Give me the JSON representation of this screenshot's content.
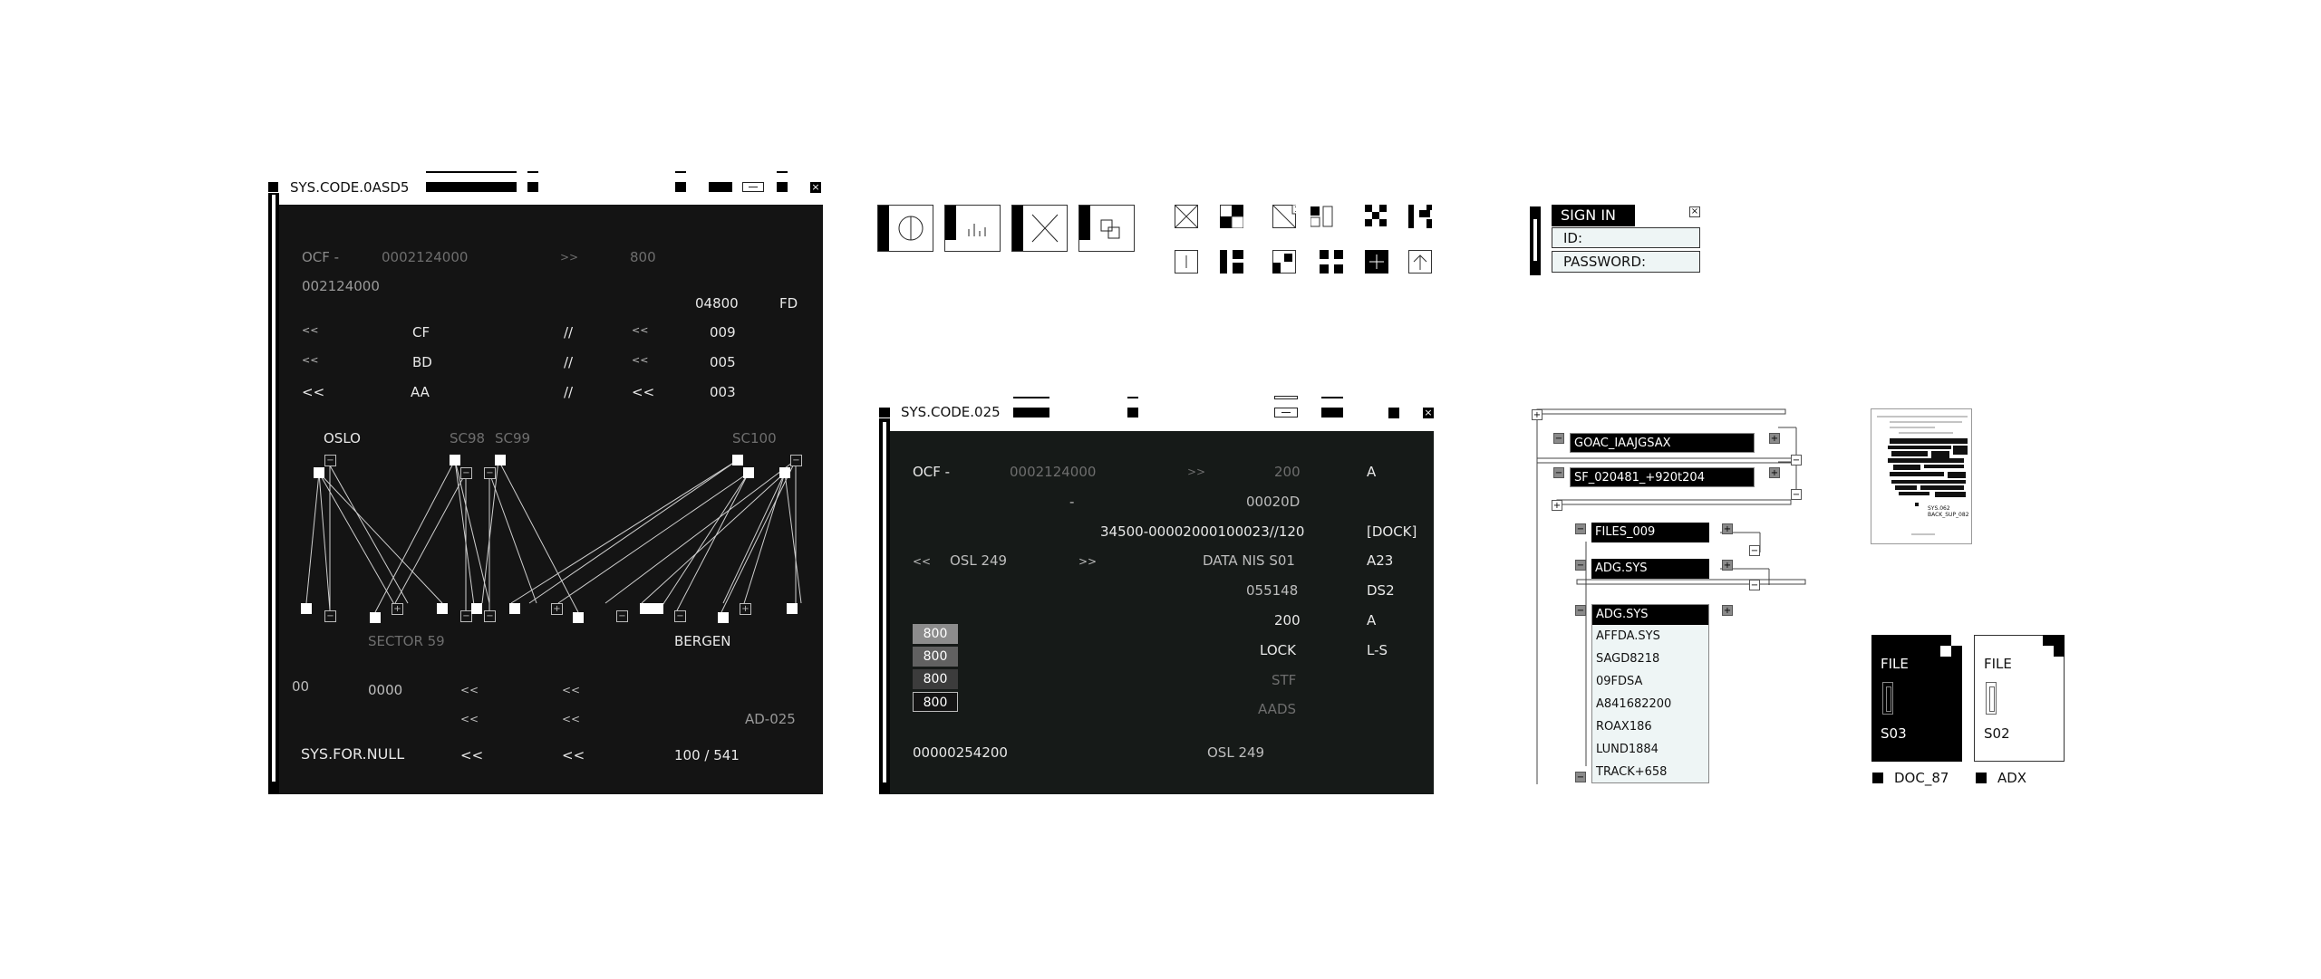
{
  "win1": {
    "title": "SYS.CODE.0ASD5",
    "ocf_label": "OCF -",
    "ocf_value": "0002124000",
    "arrow": ">>",
    "ocf_num": "800",
    "code": "002124000",
    "v04800": "04800",
    "fd": "FD",
    "rows": [
      {
        "l": "<<",
        "name": "CF",
        "sep": "//",
        "r": "<<",
        "val": "009"
      },
      {
        "l": "<<",
        "name": "BD",
        "sep": "//",
        "r": "<<",
        "val": "005"
      },
      {
        "l": "<<",
        "name": "AA",
        "sep": "//",
        "r": "<<",
        "val": "003"
      }
    ],
    "nodes_top": {
      "oslo": "OSLO",
      "sc98": "SC98",
      "sc99": "SC99",
      "sc100": "SC100"
    },
    "nodes_bottom": {
      "sector": "SECTOR 59",
      "bergen": "BERGEN"
    },
    "b_00": "00",
    "b_0000": "0000",
    "b_ll1": "<<",
    "b_ll2": "<<",
    "b_ll3": "<<",
    "b_ll4": "<<",
    "b_ad": "AD-025",
    "footer_name": "SYS.FOR.NULL",
    "footer_ll1": "<<",
    "footer_ll2": "<<",
    "footer_count": "100 / 541"
  },
  "win2": {
    "title": "SYS.CODE.025",
    "ocf_label": "OCF -",
    "ocf_value": "0002124000",
    "arrow": ">>",
    "v200": "200",
    "a": "A",
    "dash": "-",
    "v00020D": "00020D",
    "long_code": "34500-00002000100023//120",
    "dock": "[DOCK]",
    "ll": "<<",
    "osl": "OSL 249",
    "gg": ">>",
    "data_nis": "DATA NIS S01",
    "a23": "A23",
    "v055148": "055148",
    "ds2": "DS2",
    "v200b": "200",
    "a2": "A",
    "lock": "LOCK",
    "ls": "L-S",
    "stf": "STF",
    "aads": "AADS",
    "levels": [
      "800",
      "800",
      "800",
      "800"
    ],
    "footer_code": "00000254200",
    "footer_osl": "OSL 249"
  },
  "signin": {
    "title": "SIGN IN",
    "id_label": "ID:",
    "password_label": "PASSWORD:",
    "close": "×"
  },
  "tree": {
    "items": [
      "GOAC_IAAJGSAX",
      "SF_020481_+920t204",
      "FILES_009",
      "ADG.SYS",
      "ADG.SYS"
    ],
    "list": [
      "AFFDA.SYS",
      "SAGD8218",
      "09FDSA",
      "A841682200",
      "ROAX186",
      "LUND1884",
      "TRACK+658"
    ]
  },
  "doc_preview": {
    "label1": "SYS.062",
    "label2": "BACK_SUP_082"
  },
  "files": [
    {
      "title": "FILE",
      "id": "S03",
      "caption": "DOC_87"
    },
    {
      "title": "FILE",
      "id": "S02",
      "caption": "ADX"
    }
  ]
}
